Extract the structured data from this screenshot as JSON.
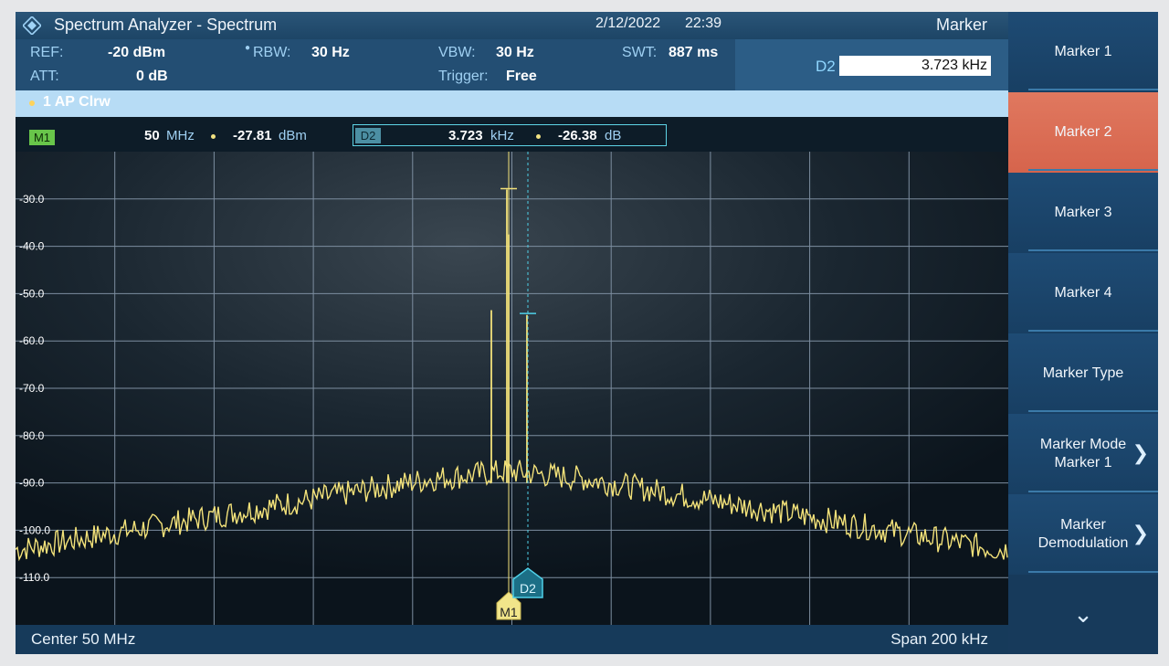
{
  "title": "Spectrum Analyzer - Spectrum",
  "date": "2/12/2022",
  "time": "22:39",
  "menu_title": "Marker",
  "settings": {
    "ref_label": "REF:",
    "ref_value": "-20 dBm",
    "att_label": "ATT:",
    "att_value": "0 dB",
    "rbw_label": "RBW:",
    "rbw_value": "30 Hz",
    "vbw_label": "VBW:",
    "vbw_value": "30 Hz",
    "trigger_label": "Trigger:",
    "trigger_value": "Free",
    "swt_label": "SWT:",
    "swt_value": "887 ms"
  },
  "d2_entry": {
    "label": "D2",
    "value": "3.723 kHz"
  },
  "trace_label": "1 AP  Clrw",
  "markers": {
    "m1_tag": "M1",
    "m1_freq": "50",
    "m1_freq_unit": "MHz",
    "m1_level": "-27.81",
    "m1_level_unit": "dBm",
    "d2_tag": "D2",
    "d2_freq": "3.723",
    "d2_freq_unit": "kHz",
    "d2_level": "-26.38",
    "d2_level_unit": "dB"
  },
  "plot_markers": {
    "m1": "M1",
    "d2": "D2"
  },
  "y_axis": {
    "labels": [
      "-30.0",
      "-40.0",
      "-50.0",
      "-60.0",
      "-70.0",
      "-80.0",
      "-90.0",
      "-100.0",
      "-110.0"
    ]
  },
  "center_label": "Center 50 MHz",
  "span_label": "Span 200 kHz",
  "softkeys": [
    {
      "label": "Marker 1",
      "active": false,
      "chevron": false
    },
    {
      "label": "Marker 2",
      "active": true,
      "chevron": false
    },
    {
      "label": "Marker 3",
      "active": false,
      "chevron": false
    },
    {
      "label": "Marker 4",
      "active": false,
      "chevron": false
    },
    {
      "label": "Marker Type",
      "active": false,
      "chevron": false
    },
    {
      "label": "Marker Mode\nMarker 1",
      "active": false,
      "chevron": true
    },
    {
      "label": "Marker\nDemodulation",
      "active": false,
      "chevron": true
    }
  ],
  "colors": {
    "trace": "#f3e27a",
    "grid": "#7d8ea0",
    "accent_active": "#e0785f",
    "d2_marker": "#4fd0e8"
  }
}
